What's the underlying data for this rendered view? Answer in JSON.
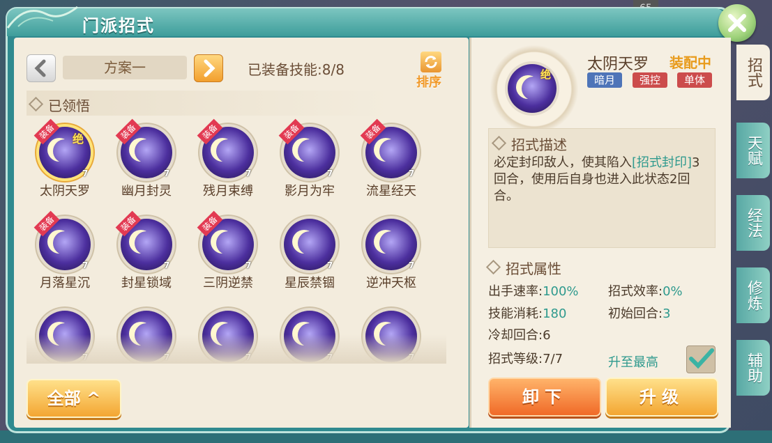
{
  "window": {
    "title": "门派招式"
  },
  "hud": {
    "level": "65"
  },
  "toolbar": {
    "plan_name": "方案一",
    "equipped_label": "已装备技能:",
    "equipped_count": "8/8",
    "sort_label": "排序"
  },
  "section": {
    "title": "已领悟"
  },
  "skills": [
    {
      "name": "太阴天罗",
      "level": "7",
      "equipped": true,
      "tag": "装备",
      "ultimate": "绝"
    },
    {
      "name": "幽月封灵",
      "level": "7",
      "equipped": true,
      "tag": "装备"
    },
    {
      "name": "残月束缚",
      "level": "7",
      "equipped": true,
      "tag": "装备"
    },
    {
      "name": "影月为牢",
      "level": "7",
      "equipped": true,
      "tag": "装备"
    },
    {
      "name": "流星经天",
      "level": "7",
      "equipped": true,
      "tag": "装备"
    },
    {
      "name": "月落星沉",
      "level": "7",
      "equipped": true,
      "tag": "装备"
    },
    {
      "name": "封星锁域",
      "level": "7",
      "equipped": true,
      "tag": "装备"
    },
    {
      "name": "三阴逆禁",
      "level": "7",
      "equipped": true,
      "tag": "装备"
    },
    {
      "name": "星辰禁锢",
      "level": "7",
      "equipped": false
    },
    {
      "name": "逆冲天枢",
      "level": "7",
      "equipped": false
    },
    {
      "name": "",
      "level": "7",
      "equipped": false
    },
    {
      "name": "",
      "level": "7",
      "equipped": false
    },
    {
      "name": "",
      "level": "7",
      "equipped": false
    },
    {
      "name": "",
      "level": "7",
      "equipped": false
    },
    {
      "name": "",
      "level": "7",
      "equipped": false
    }
  ],
  "filter": {
    "label": "全部"
  },
  "detail": {
    "ultimate": "绝",
    "name": "太阴天罗",
    "status": "装配中",
    "badges": [
      "暗月",
      "强控",
      "单体"
    ],
    "desc_title": "招式描述",
    "desc_pre": "必定封印敌人，使其陷入",
    "desc_highlight": "[招式封印]",
    "desc_post": "3回合，使用后自身也进入此状态2回合。",
    "attr_title": "招式属性",
    "attrs": {
      "speed": {
        "label": "出手速率:",
        "value": "100%"
      },
      "efficiency": {
        "label": "招式效率:",
        "value": "0%"
      },
      "cost": {
        "label": "技能消耗:",
        "value": "180"
      },
      "initial": {
        "label": "初始回合:",
        "value": "3"
      },
      "cooldown": {
        "label": "冷却回合:",
        "value": "6"
      },
      "level": {
        "label": "招式等级:",
        "value": "7/7"
      }
    },
    "maxed_label": "升至最高",
    "unequip_label": "卸下",
    "upgrade_label": "升级"
  },
  "side_tabs": [
    "招式",
    "天赋",
    "经法",
    "修炼",
    "辅助"
  ]
}
